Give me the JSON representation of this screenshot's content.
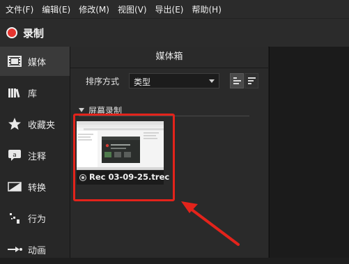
{
  "menubar": {
    "items": [
      "文件(F)",
      "编辑(E)",
      "修改(M)",
      "视图(V)",
      "导出(E)",
      "帮助(H)"
    ]
  },
  "titlebar": {
    "record_label": "录制",
    "record_color": "#e5342f"
  },
  "sidebar": {
    "items": [
      {
        "label": "媒体",
        "icon": "film-icon",
        "active": true
      },
      {
        "label": "库",
        "icon": "library-icon",
        "active": false
      },
      {
        "label": "收藏夹",
        "icon": "star-icon",
        "active": false
      },
      {
        "label": "注释",
        "icon": "annotation-icon",
        "active": false
      },
      {
        "label": "转换",
        "icon": "transition-icon",
        "active": false
      },
      {
        "label": "行为",
        "icon": "behavior-icon",
        "active": false
      },
      {
        "label": "动画",
        "icon": "animation-icon",
        "active": false
      }
    ]
  },
  "panel": {
    "title": "媒体箱",
    "sort_label": "排序方式",
    "sort_value": "类型",
    "section_title": "屏幕录制",
    "media_items": [
      {
        "name": "Rec 03-09-25.trec"
      }
    ]
  },
  "annotation": {
    "color": "#e3231b"
  }
}
